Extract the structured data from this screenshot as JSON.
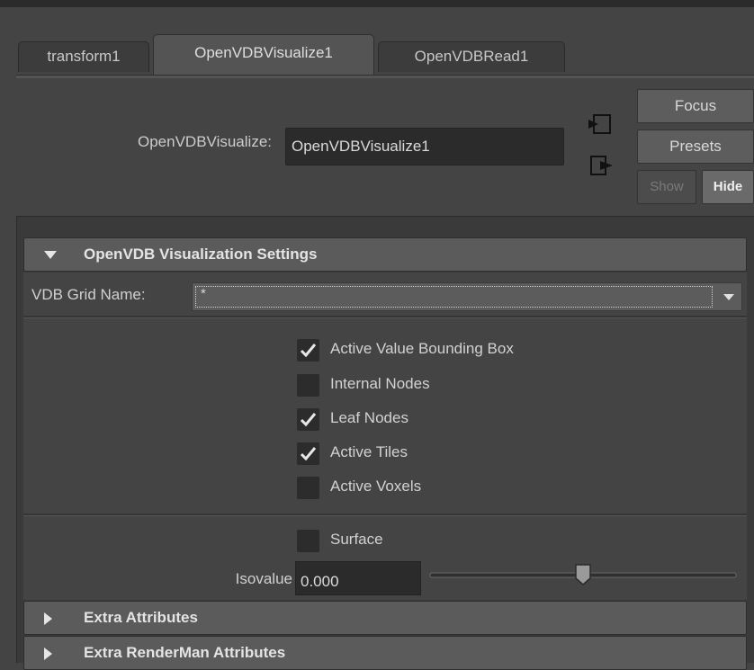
{
  "tabs": [
    {
      "label": "transform1",
      "active": false
    },
    {
      "label": "OpenVDBVisualize1",
      "active": true
    },
    {
      "label": "OpenVDBRead1",
      "active": false
    }
  ],
  "header": {
    "node_type_label": "OpenVDBVisualize:",
    "node_name": "OpenVDBVisualize1",
    "buttons": {
      "focus": "Focus",
      "presets": "Presets",
      "show": "Show",
      "hide": "Hide"
    },
    "icons": {
      "input": "input-connection-icon",
      "output": "output-connection-icon"
    }
  },
  "sections": {
    "vis": {
      "title": "OpenVDB Visualization Settings",
      "expanded": true
    },
    "extra": {
      "title": "Extra Attributes",
      "expanded": false
    },
    "renderman": {
      "title": "Extra RenderMan Attributes",
      "expanded": false
    }
  },
  "grid": {
    "label": "VDB Grid Name:",
    "value": "*"
  },
  "checkboxes": [
    {
      "label": "Active Value Bounding Box",
      "checked": true
    },
    {
      "label": "Internal Nodes",
      "checked": false
    },
    {
      "label": "Leaf Nodes",
      "checked": true
    },
    {
      "label": "Active Tiles",
      "checked": true
    },
    {
      "label": "Active Voxels",
      "checked": false
    }
  ],
  "surface": {
    "label": "Surface",
    "checked": false
  },
  "isovalue": {
    "label": "Isovalue",
    "value": "0.000",
    "slider_position": 0.5
  },
  "colors": {
    "panel": "#444444",
    "section_header": "#5b5b5b",
    "field": "#2b2b2b",
    "checkbox": "#2c2c2c"
  }
}
